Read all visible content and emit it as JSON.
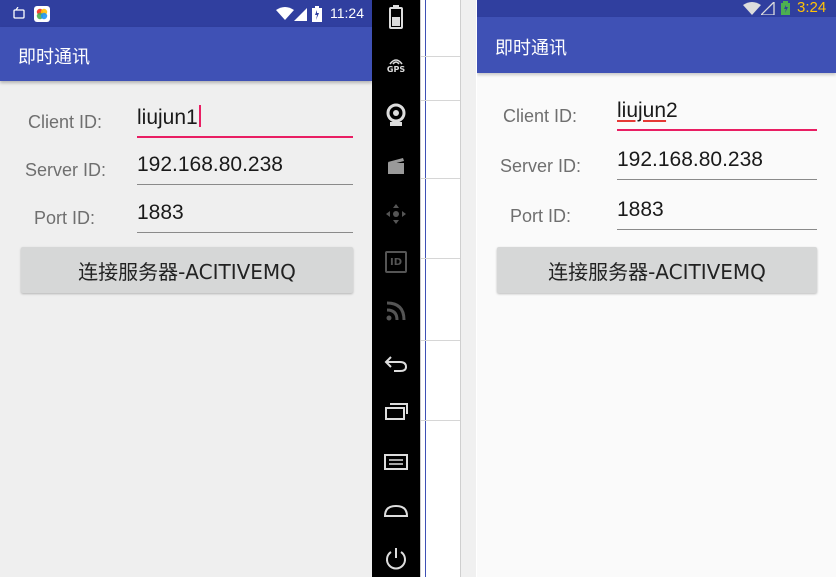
{
  "left_phone": {
    "status_time": "11:24",
    "app_title": "即时通讯",
    "client_label": "Client ID:",
    "client_value": "liujun1",
    "server_label": "Server ID:",
    "server_value": "192.168.80.238",
    "port_label": "Port ID:",
    "port_value": "1883",
    "connect_button": "连接服务器-ACITIVEMQ"
  },
  "emulator_bar": {
    "gps_label": "GPS",
    "id_label": "ID",
    "icons": [
      "battery-icon",
      "gps-icon",
      "camera-icon",
      "clapperboard-icon",
      "dpad-icon",
      "id-icon",
      "rss-icon",
      "back-icon",
      "recents-icon",
      "menu-icon",
      "home-icon",
      "power-icon"
    ]
  },
  "right_phone": {
    "status_time": "3:24",
    "app_title": "即时通讯",
    "client_label": "Client ID:",
    "client_value_underlined": "liujun",
    "client_value_rest": "2",
    "server_label": "Server ID:",
    "server_value": "192.168.80.238",
    "port_label": "Port ID:",
    "port_value": "1883",
    "connect_button": "连接服务器-ACITIVEMQ"
  },
  "colors": {
    "primary": "#3f51b5",
    "primary_dark": "#303f9f",
    "accent": "#e91e63"
  }
}
